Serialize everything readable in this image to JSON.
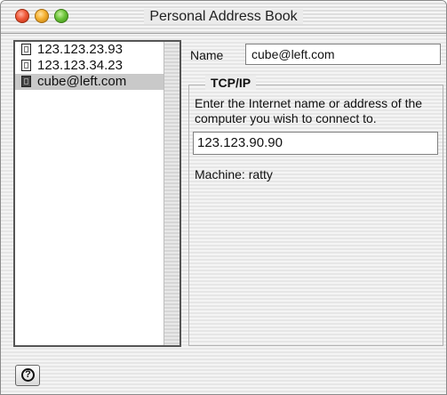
{
  "window": {
    "title": "Personal Address Book"
  },
  "sidebar": {
    "items": [
      {
        "label": "123.123.23.93",
        "icon": "document-icon"
      },
      {
        "label": "123.123.34.23",
        "icon": "document-icon"
      },
      {
        "label": "cube@left.com",
        "icon": "document-icon",
        "selected": true
      }
    ]
  },
  "form": {
    "name_label": "Name",
    "name_value": "cube@left.com",
    "group_title": "TCP/IP",
    "group_description": "Enter the Internet name or address of the computer you wish to connect to.",
    "address_value": "123.123.90.90",
    "machine_text": "Machine:  ratty"
  },
  "help": {
    "icon": "help-icon",
    "glyph": "?"
  }
}
